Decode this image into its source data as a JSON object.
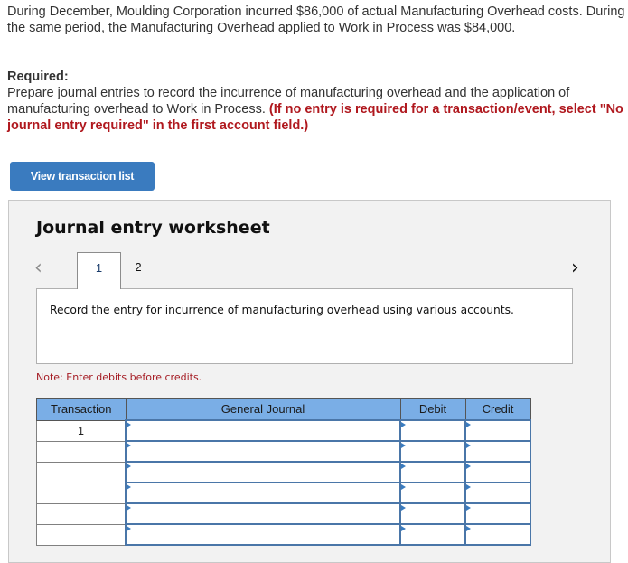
{
  "problem": {
    "intro": "During December, Moulding Corporation incurred $86,000 of actual Manufacturing Overhead costs. During the same period, the Manufacturing Overhead applied to Work in Process was $84,000.",
    "required_heading": "Required:",
    "required_text": "Prepare journal entries to record the incurrence of manufacturing overhead and the application of manufacturing overhead to Work in Process.",
    "required_instruction": "(If no entry is required for a transaction/event, select \"No journal entry required\" in the first account field.)"
  },
  "buttons": {
    "view_transaction_list": "View transaction list"
  },
  "worksheet": {
    "title": "Journal entry worksheet",
    "prev_icon": "‹",
    "next_icon": "›",
    "tabs": [
      {
        "label": "1",
        "active": true
      },
      {
        "label": "2",
        "active": false
      }
    ],
    "description": "Record the entry for incurrence of manufacturing overhead using various accounts.",
    "note": "Note: Enter debits before credits.",
    "table": {
      "headers": [
        "Transaction",
        "General Journal",
        "Debit",
        "Credit"
      ],
      "rows": [
        {
          "transaction": "1",
          "account": "",
          "debit": "",
          "credit": ""
        },
        {
          "transaction": "",
          "account": "",
          "debit": "",
          "credit": ""
        },
        {
          "transaction": "",
          "account": "",
          "debit": "",
          "credit": ""
        },
        {
          "transaction": "",
          "account": "",
          "debit": "",
          "credit": ""
        },
        {
          "transaction": "",
          "account": "",
          "debit": "",
          "credit": ""
        },
        {
          "transaction": "",
          "account": "",
          "debit": "",
          "credit": ""
        }
      ]
    }
  }
}
